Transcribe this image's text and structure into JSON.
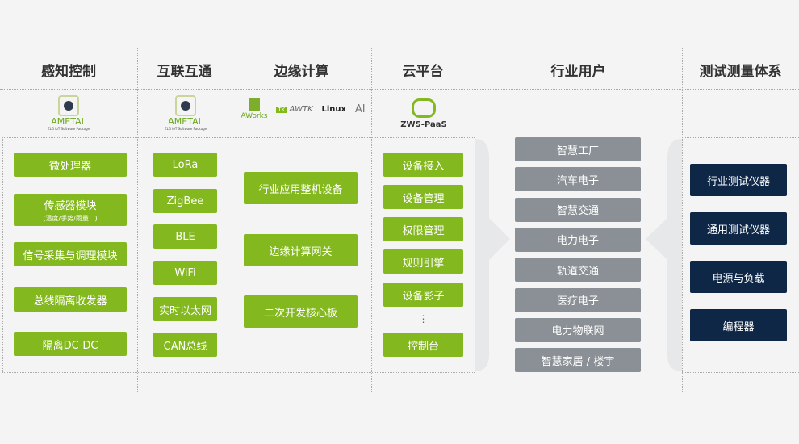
{
  "headers": [
    "感知控制",
    "互联互通",
    "边缘计算",
    "云平台",
    "行业用户",
    "测试测量体系"
  ],
  "logos": {
    "ametal": "AMETAL",
    "ametal_tag": "ZLG IoT Software Package",
    "aworks": "AWorks",
    "awtk": "AWTK",
    "linux": "Linux",
    "ai": "AI",
    "zws": "ZWS-PaaS"
  },
  "sensing": [
    {
      "label": "微处理器"
    },
    {
      "label": "传感器模块",
      "sub": "(温度/手势/雨量...)"
    },
    {
      "label": "信号采集与调理模块"
    },
    {
      "label": "总线隔离收发器"
    },
    {
      "label": "隔离DC-DC"
    }
  ],
  "connect": [
    "LoRa",
    "ZigBee",
    "BLE",
    "WiFi",
    "实时以太网",
    "CAN总线"
  ],
  "edge": [
    "行业应用整机设备",
    "边缘计算网关",
    "二次开发核心板"
  ],
  "cloud": [
    "设备接入",
    "设备管理",
    "权限管理",
    "规则引擎",
    "设备影子",
    "⋮",
    "控制台"
  ],
  "industry": [
    "智慧工厂",
    "汽车电子",
    "智慧交通",
    "电力电子",
    "轨道交通",
    "医疗电子",
    "电力物联网",
    "智慧家居 / 楼宇"
  ],
  "test": [
    "行业测试仪器",
    "通用测试仪器",
    "电源与负载",
    "编程器"
  ],
  "colors": {
    "green": "#84b81f",
    "grey": "#8a9095",
    "navy": "#0f2747"
  }
}
